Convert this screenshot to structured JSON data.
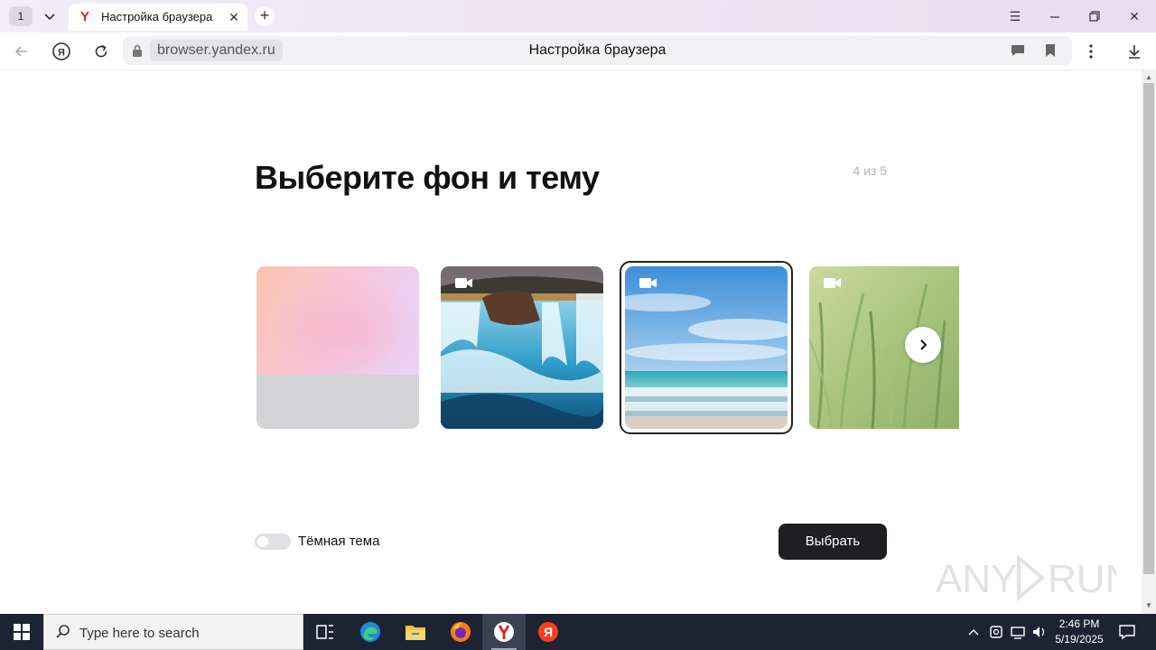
{
  "browser": {
    "tab_count": "1",
    "tab_title": "Настройка браузера",
    "tab_favicon": "Y",
    "url_host": "browser.yandex.ru",
    "page_title": "Настройка браузера"
  },
  "page": {
    "heading": "Выберите фон и тему",
    "step": "4 из 5",
    "backgrounds": [
      {
        "id": "gradient",
        "video": false,
        "selected": false
      },
      {
        "id": "waterfall",
        "video": true,
        "selected": false
      },
      {
        "id": "sea",
        "video": true,
        "selected": true
      },
      {
        "id": "grass",
        "video": true,
        "selected": false
      }
    ],
    "dark_theme_label": "Тёмная тема",
    "dark_theme_on": false,
    "choose_button": "Выбрать"
  },
  "taskbar": {
    "search_placeholder": "Type here to search",
    "time": "2:46 PM",
    "date": "5/19/2025"
  },
  "watermark": "ANY RUN",
  "colors": {
    "accent_dark": "#1f1f23",
    "taskbar": "#1c2433",
    "yandex_red": "#e0201b"
  }
}
